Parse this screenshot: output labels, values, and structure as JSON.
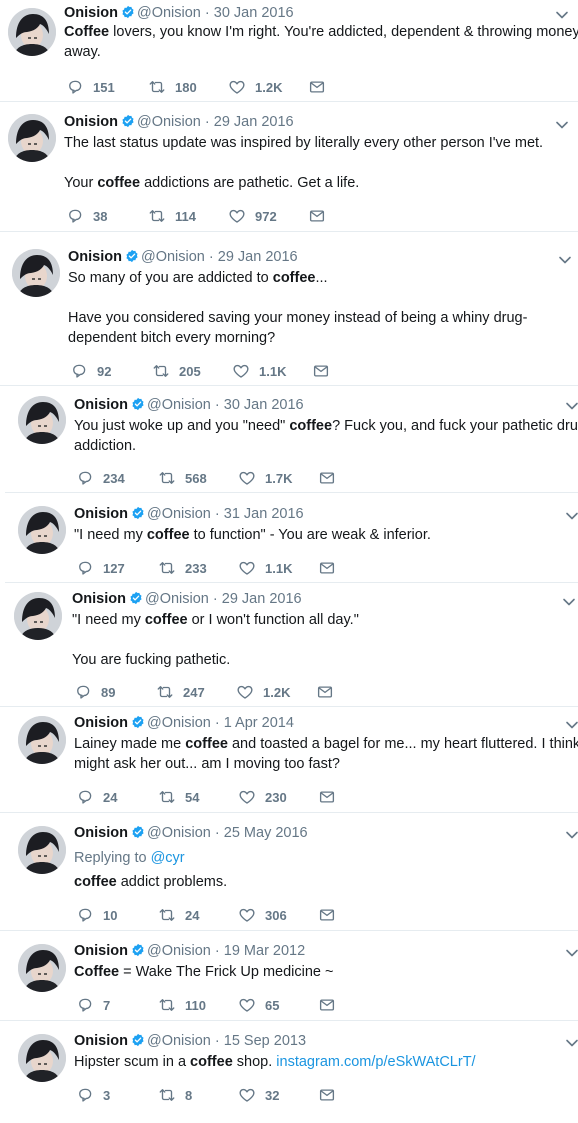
{
  "tweets": [
    {
      "name": "Onision",
      "handle": "@Onision",
      "date": "30 Jan 2016",
      "lines": [
        [
          "",
          "Coffee",
          " lovers, you know I'm right. You're addicted, dependent & throwing money"
        ],
        [
          "",
          "",
          "away."
        ]
      ],
      "replies": "151",
      "retweets": "180",
      "likes": "1.2K"
    },
    {
      "name": "Onision",
      "handle": "@Onision",
      "date": "29 Jan 2016",
      "lines": [
        [
          "The last status update was inspired by literally every other person I've met.",
          "",
          ""
        ],
        [
          "GAP",
          "",
          ""
        ],
        [
          "Your ",
          "coffee",
          " addictions are pathetic. Get a life."
        ]
      ],
      "replies": "38",
      "retweets": "114",
      "likes": "972"
    },
    {
      "name": "Onision",
      "handle": "@Onision",
      "date": "29 Jan 2016",
      "lines": [
        [
          "So many of you are addicted to ",
          "coffee",
          "..."
        ],
        [
          "GAP",
          "",
          ""
        ],
        [
          "Have you considered saving your money instead of being a whiny drug-",
          "",
          ""
        ],
        [
          "dependent bitch every morning?",
          "",
          ""
        ]
      ],
      "replies": "92",
      "retweets": "205",
      "likes": "1.1K"
    },
    {
      "name": "Onision",
      "handle": "@Onision",
      "date": "30 Jan 2016",
      "lines": [
        [
          "You just woke up and you \"need\" ",
          "coffee",
          "? Fuck you, and fuck your pathetic drug"
        ],
        [
          "addiction.",
          "",
          ""
        ]
      ],
      "replies": "234",
      "retweets": "568",
      "likes": "1.7K"
    },
    {
      "name": "Onision",
      "handle": "@Onision",
      "date": "31 Jan 2016",
      "lines": [
        [
          "\"I need my ",
          "coffee",
          " to function\" - You are weak & inferior."
        ]
      ],
      "replies": "127",
      "retweets": "233",
      "likes": "1.1K"
    },
    {
      "name": "Onision",
      "handle": "@Onision",
      "date": "29 Jan 2016",
      "lines": [
        [
          "\"I need my ",
          "coffee",
          " or I won't function all day.\""
        ],
        [
          "GAP",
          "",
          ""
        ],
        [
          "You are fucking pathetic.",
          "",
          ""
        ]
      ],
      "replies": "89",
      "retweets": "247",
      "likes": "1.2K"
    },
    {
      "name": "Onision",
      "handle": "@Onision",
      "date": "1 Apr 2014",
      "lines": [
        [
          "Lainey made me ",
          "coffee",
          " and toasted a bagel for me... my heart fluttered. I think I"
        ],
        [
          "might ask her out... am I moving too fast?",
          "",
          ""
        ]
      ],
      "replies": "24",
      "retweets": "54",
      "likes": "230"
    },
    {
      "name": "Onision",
      "handle": "@Onision",
      "date": "25 May 2016",
      "reply_prefix": "Replying to ",
      "reply_user": "@cyr",
      "lines": [
        [
          "",
          "coffee",
          " addict problems."
        ]
      ],
      "replies": "10",
      "retweets": "24",
      "likes": "306"
    },
    {
      "name": "Onision",
      "handle": "@Onision",
      "date": "19 Mar 2012",
      "lines": [
        [
          "",
          "Coffee",
          " = Wake The Frick Up medicine ~"
        ]
      ],
      "replies": "7",
      "retweets": "110",
      "likes": "65"
    },
    {
      "name": "Onision",
      "handle": "@Onision",
      "date": "15 Sep 2013",
      "lines": [
        [
          "Hipster scum in a ",
          "coffee",
          " shop. "
        ]
      ],
      "link": "instagram.com/p/eSkWAtCLrT/",
      "replies": "3",
      "retweets": "8",
      "likes": "32"
    }
  ],
  "colors": {
    "link": "#1b95e0",
    "muted": "#657786",
    "verified": "#1da1f2",
    "separator": "#e6ecf0"
  },
  "icons": {
    "reply": "reply-icon",
    "retweet": "retweet-icon",
    "like": "heart-icon",
    "dm": "envelope-icon",
    "verified": "verified-badge-icon",
    "menu": "chevron-down-icon"
  }
}
